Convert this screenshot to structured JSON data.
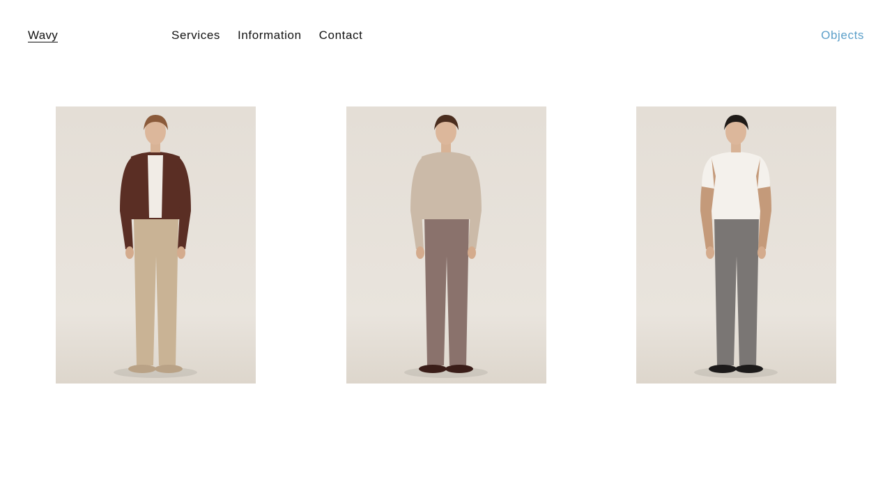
{
  "header": {
    "brand": "Wavy",
    "nav": [
      {
        "label": "Services"
      },
      {
        "label": "Information"
      },
      {
        "label": "Contact"
      }
    ],
    "objects_label": "Objects"
  },
  "colors": {
    "text": "#111111",
    "accent": "#5b9fc9",
    "background": "#ffffff",
    "photo_backdrop": "#e6e1da"
  },
  "gallery": {
    "items": [
      {
        "top": "#5a2e24",
        "shirt": "#f1ece6",
        "trousers": "#c9b395",
        "shoes": "#b9a286",
        "hair": "#8a5a3a"
      },
      {
        "top": "#cbbaa8",
        "shirt": "#cbbaa8",
        "trousers": "#8a726c",
        "shoes": "#3a1d18",
        "hair": "#4a2d1e"
      },
      {
        "top": "#f4f1ec",
        "shirt": "#f4f1ec",
        "trousers": "#7a7674",
        "shoes": "#1c1a1a",
        "hair": "#1f1a17"
      }
    ]
  }
}
